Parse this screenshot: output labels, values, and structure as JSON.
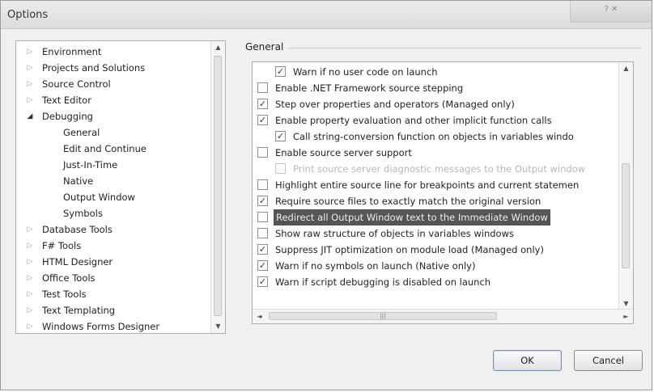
{
  "window": {
    "title": "Options",
    "title_controls": "? ✕"
  },
  "tree": {
    "scroll_up": "▲",
    "scroll_down": "▼",
    "items": [
      {
        "label": "Environment",
        "arrow": "▷",
        "open": false,
        "indent": 0
      },
      {
        "label": "Projects and Solutions",
        "arrow": "▷",
        "open": false,
        "indent": 0
      },
      {
        "label": "Source Control",
        "arrow": "▷",
        "open": false,
        "indent": 0
      },
      {
        "label": "Text Editor",
        "arrow": "▷",
        "open": false,
        "indent": 0
      },
      {
        "label": "Debugging",
        "arrow": "◢",
        "open": true,
        "indent": 0
      },
      {
        "label": "General",
        "arrow": "",
        "open": false,
        "indent": 1
      },
      {
        "label": "Edit and Continue",
        "arrow": "",
        "open": false,
        "indent": 1
      },
      {
        "label": "Just-In-Time",
        "arrow": "",
        "open": false,
        "indent": 1
      },
      {
        "label": "Native",
        "arrow": "",
        "open": false,
        "indent": 1
      },
      {
        "label": "Output Window",
        "arrow": "",
        "open": false,
        "indent": 1
      },
      {
        "label": "Symbols",
        "arrow": "",
        "open": false,
        "indent": 1
      },
      {
        "label": "Database Tools",
        "arrow": "▷",
        "open": false,
        "indent": 0
      },
      {
        "label": "F# Tools",
        "arrow": "▷",
        "open": false,
        "indent": 0
      },
      {
        "label": "HTML Designer",
        "arrow": "▷",
        "open": false,
        "indent": 0
      },
      {
        "label": "Office Tools",
        "arrow": "▷",
        "open": false,
        "indent": 0
      },
      {
        "label": "Test Tools",
        "arrow": "▷",
        "open": false,
        "indent": 0
      },
      {
        "label": "Text Templating",
        "arrow": "▷",
        "open": false,
        "indent": 0
      },
      {
        "label": "Windows Forms Designer",
        "arrow": "▷",
        "open": false,
        "indent": 0
      }
    ]
  },
  "group": {
    "label": "General"
  },
  "options": {
    "scroll_up": "▲",
    "scroll_down": "▼",
    "scroll_left": "◄",
    "scroll_right": "►",
    "hthumb_grip": "|||",
    "check_mark": "✓",
    "items": [
      {
        "label": "Warn if no user code on launch",
        "checked": true,
        "indent": 1,
        "disabled": false,
        "selected": false
      },
      {
        "label": "Enable .NET Framework source stepping",
        "checked": false,
        "indent": 0,
        "disabled": false,
        "selected": false
      },
      {
        "label": "Step over properties and operators (Managed only)",
        "checked": true,
        "indent": 0,
        "disabled": false,
        "selected": false
      },
      {
        "label": "Enable property evaluation and other implicit function calls",
        "checked": true,
        "indent": 0,
        "disabled": false,
        "selected": false
      },
      {
        "label": "Call string-conversion function on objects in variables windo",
        "checked": true,
        "indent": 1,
        "disabled": false,
        "selected": false
      },
      {
        "label": "Enable source server support",
        "checked": false,
        "indent": 0,
        "disabled": false,
        "selected": false
      },
      {
        "label": "Print source server diagnostic messages to the Output window",
        "checked": false,
        "indent": 1,
        "disabled": true,
        "selected": false
      },
      {
        "label": "Highlight entire source line for breakpoints and current statemen",
        "checked": false,
        "indent": 0,
        "disabled": false,
        "selected": false
      },
      {
        "label": "Require source files to exactly match the original version",
        "checked": true,
        "indent": 0,
        "disabled": false,
        "selected": false
      },
      {
        "label": "Redirect all Output Window text to the Immediate Window",
        "checked": false,
        "indent": 0,
        "disabled": false,
        "selected": true
      },
      {
        "label": "Show raw structure of objects in variables windows",
        "checked": false,
        "indent": 0,
        "disabled": false,
        "selected": false
      },
      {
        "label": "Suppress JIT optimization on module load (Managed only)",
        "checked": true,
        "indent": 0,
        "disabled": false,
        "selected": false
      },
      {
        "label": "Warn if no symbols on launch (Native only)",
        "checked": true,
        "indent": 0,
        "disabled": false,
        "selected": false
      },
      {
        "label": "Warn if script debugging is disabled on launch",
        "checked": true,
        "indent": 0,
        "disabled": false,
        "selected": false
      }
    ]
  },
  "buttons": {
    "ok": "OK",
    "cancel": "Cancel"
  }
}
